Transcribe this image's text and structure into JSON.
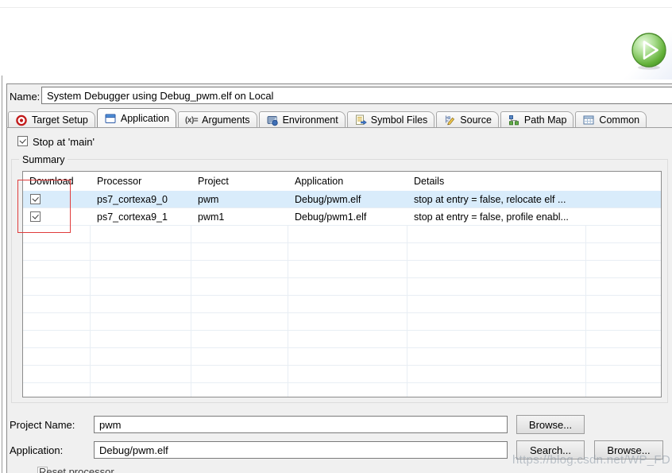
{
  "name_row": {
    "label": "Name:",
    "value": "System Debugger using Debug_pwm.elf on Local"
  },
  "tabs": [
    {
      "label": "Target Setup",
      "selected": false
    },
    {
      "label": "Application",
      "selected": true
    },
    {
      "label": "Arguments",
      "glyph": "(x)=",
      "selected": false
    },
    {
      "label": "Environment",
      "selected": false
    },
    {
      "label": "Symbol Files",
      "selected": false
    },
    {
      "label": "Source",
      "selected": false
    },
    {
      "label": "Path Map",
      "selected": false
    },
    {
      "label": "Common",
      "selected": false
    }
  ],
  "stop_at_main": {
    "label": "Stop at 'main'",
    "checked": true
  },
  "summary": {
    "group_label": "Summary",
    "table": {
      "columns": [
        "Download",
        "Processor",
        "Project",
        "Application",
        "Details"
      ],
      "rows": [
        {
          "download": true,
          "processor": "ps7_cortexa9_0",
          "project": "pwm",
          "application": "Debug/pwm.elf",
          "details": "stop at entry = false, relocate elf ...",
          "selected": true
        },
        {
          "download": true,
          "processor": "ps7_cortexa9_1",
          "project": "pwm1",
          "application": "Debug/pwm1.elf",
          "details": "stop at entry = false, profile enabl...",
          "selected": false
        }
      ]
    }
  },
  "fields": {
    "project_name": {
      "label": "Project Name:",
      "value": "pwm",
      "browse_label": "Browse..."
    },
    "application": {
      "label": "Application:",
      "value": "Debug/pwm.elf",
      "search_label": "Search...",
      "browse_label": "Browse..."
    }
  },
  "reset_processor": {
    "label": "Reset processor",
    "checked": false
  },
  "watermark": "https://blog.csdn.net/WP_FD",
  "colors": {
    "row_highlight": "#d9ecfb",
    "annotation_red": "#e03c3c",
    "run_green": "#57a933",
    "dialog_bg": "#f0f0f0"
  }
}
